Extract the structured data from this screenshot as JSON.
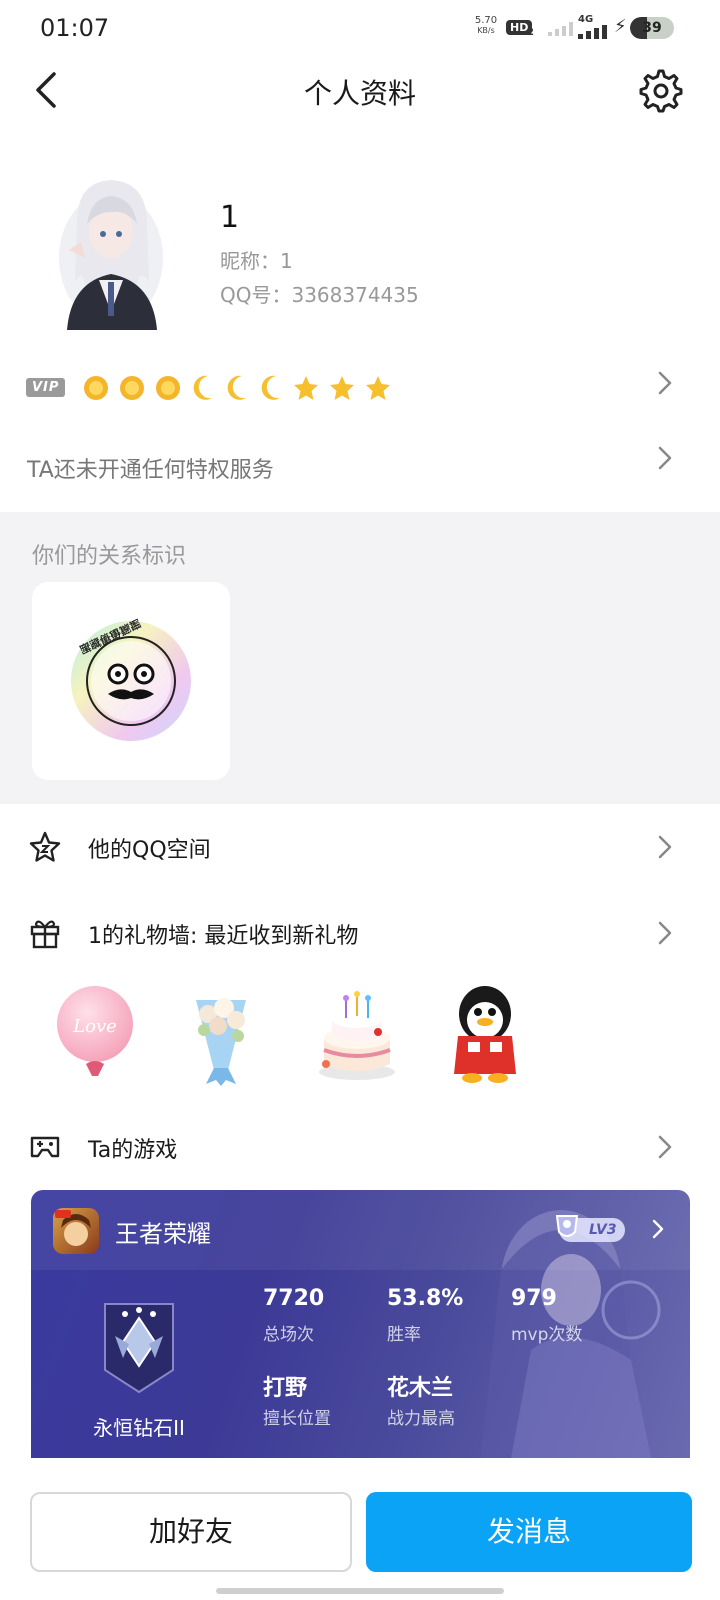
{
  "status_bar": {
    "time": "01:07",
    "net_speed": "5.70",
    "net_speed_unit": "KB/s",
    "hd_label": "HD",
    "hd_sub": "2",
    "network": "4G",
    "battery_level": "39",
    "battery_fraction": 0.39
  },
  "nav": {
    "title": "个人资料",
    "back_icon": "back-chevron-icon",
    "settings_icon": "gear-icon"
  },
  "profile": {
    "name": "1",
    "nickname_line": "昵称：1",
    "qq_line": "QQ号：3368374435"
  },
  "vip": {
    "badge": "VIP",
    "level_icons": [
      "sun",
      "sun",
      "sun",
      "moon",
      "moon",
      "moon",
      "star",
      "star",
      "star"
    ]
  },
  "privilege": {
    "text": "TA还未开通任何特权服务"
  },
  "relation": {
    "title": "你们的关系标识",
    "badge_text": "宝藏值得挖掘"
  },
  "rows": {
    "qzone": "他的QQ空间",
    "gifts": "1的礼物墙: 最近收到新礼物",
    "games": "Ta的游戏"
  },
  "gift_items": [
    "love-balloon",
    "flower-bouquet",
    "birthday-cake",
    "penguin-doll"
  ],
  "gift_balloon_text": "Love",
  "game": {
    "name": "王者荣耀",
    "level": "LV3",
    "rank": "永恒钻石II",
    "stats": {
      "matches_value": "7720",
      "matches_label": "总场次",
      "winrate_value": "53.8%",
      "winrate_label": "胜率",
      "mvp_value": "979",
      "mvp_label": "mvp次数",
      "position_value": "打野",
      "position_label": "擅长位置",
      "hero_value": "花木兰",
      "hero_label": "战力最高"
    }
  },
  "buttons": {
    "add_friend": "加好友",
    "send_message": "发消息"
  },
  "colors": {
    "primary_blue": "#0aa3f5",
    "relation_bg": "#f3f3f6",
    "game_card": "#3a3aa0"
  }
}
